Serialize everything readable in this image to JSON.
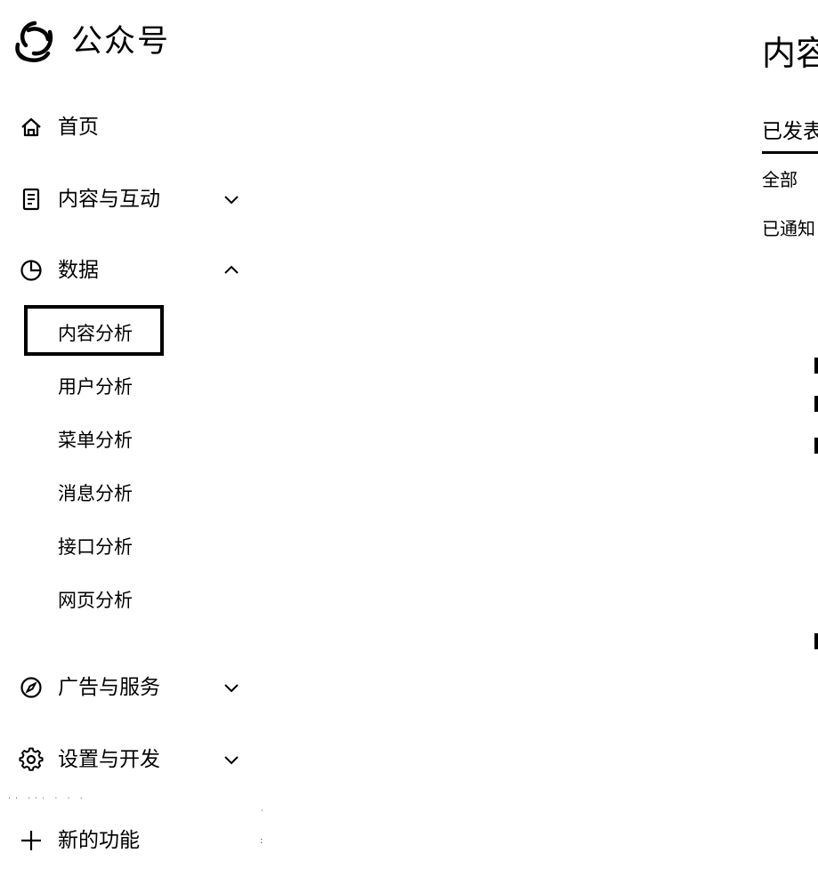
{
  "brand": {
    "name": "公众号"
  },
  "sidebar": {
    "items": [
      {
        "label": "首页",
        "icon": "home-icon"
      },
      {
        "label": "内容与互动",
        "icon": "document-icon",
        "expanded": false
      },
      {
        "label": "数据",
        "icon": "pie-chart-icon",
        "expanded": true
      },
      {
        "label": "广告与服务",
        "icon": "compass-icon",
        "expanded": false
      },
      {
        "label": "设置与开发",
        "icon": "gear-icon",
        "expanded": false
      }
    ],
    "data_sub_items": [
      {
        "label": "内容分析",
        "active": true
      },
      {
        "label": "用户分析"
      },
      {
        "label": "菜单分析"
      },
      {
        "label": "消息分析"
      },
      {
        "label": "接口分析"
      },
      {
        "label": "网页分析"
      }
    ],
    "new_features": {
      "label": "新的功能",
      "icon": "plus-icon"
    }
  },
  "main": {
    "title": "内容",
    "tab_label": "已发表",
    "filters": {
      "all": "全部",
      "notified": "已通知"
    }
  }
}
